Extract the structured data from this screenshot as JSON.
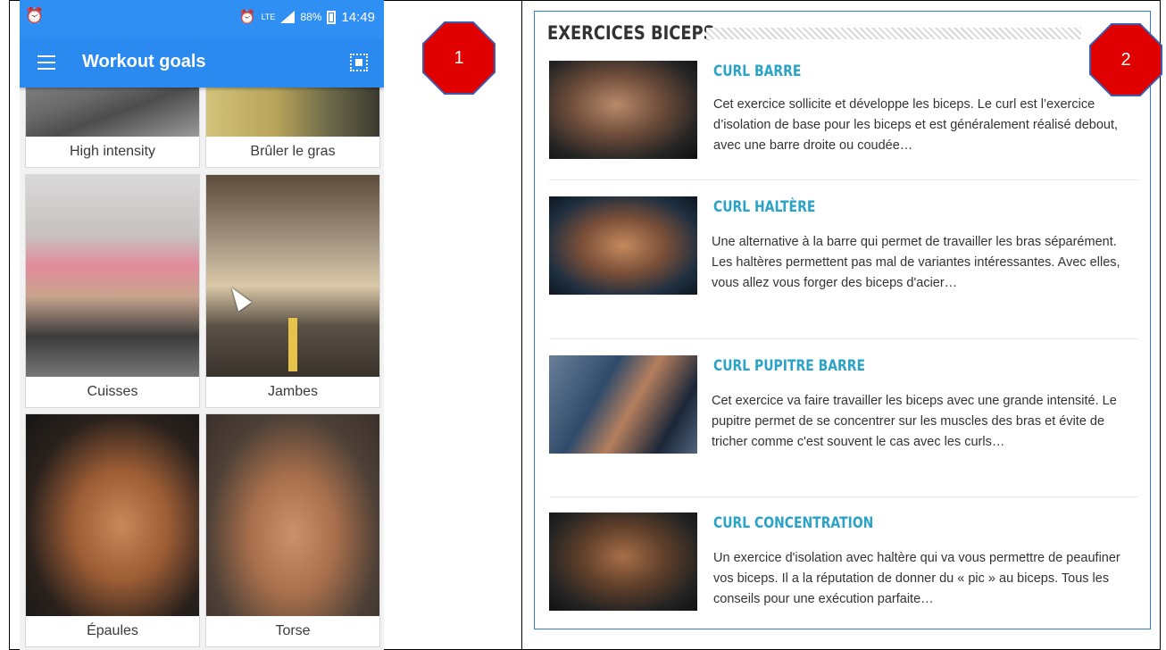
{
  "status_bar": {
    "battery": "88%",
    "time": "14:49",
    "network": "LTE"
  },
  "app_bar": {
    "title": "Workout goals"
  },
  "grid": [
    {
      "label": "High intensity",
      "icon": "treadmill-photo"
    },
    {
      "label": "Brûler le gras",
      "icon": "field-photo"
    },
    {
      "label": "Cuisses",
      "icon": "runner-woman-photo"
    },
    {
      "label": "Jambes",
      "icon": "running-road-photo"
    },
    {
      "label": "Épaules",
      "icon": "back-shoulders-photo"
    },
    {
      "label": "Torse",
      "icon": "torso-photo"
    }
  ],
  "markers": {
    "left": "1",
    "right": "2"
  },
  "article": {
    "heading": "EXERCICES BICEPS",
    "items": [
      {
        "title": "CURL BARRE",
        "text": "Cet exercice sollicite et développe les biceps. Le curl est l’exercice d’isolation de base pour les biceps et est généralement réalisé debout, avec une barre droite ou coudée…"
      },
      {
        "title": "CURL HALTÈRE",
        "text": "Une alternative à la barre qui permet de travailler les bras séparément. Les haltères permettent pas mal de variantes intéressantes. Avec elles, vous allez vous forger des biceps d'acier…"
      },
      {
        "title": "CURL PUPITRE BARRE",
        "text": "Cet exercice va faire travailler les biceps avec une grande intensité. Le pupitre permet de se concentrer sur les muscles des bras et évite de tricher comme c'est souvent le cas avec les curls…"
      },
      {
        "title": "CURL CONCENTRATION",
        "text": "Un exercice d'isolation avec haltère qui va vous permettre de peaufiner vos biceps. Il a la réputation de donner du « pic » au biceps. Tous les conseils pour une exécution parfaite…"
      }
    ]
  }
}
